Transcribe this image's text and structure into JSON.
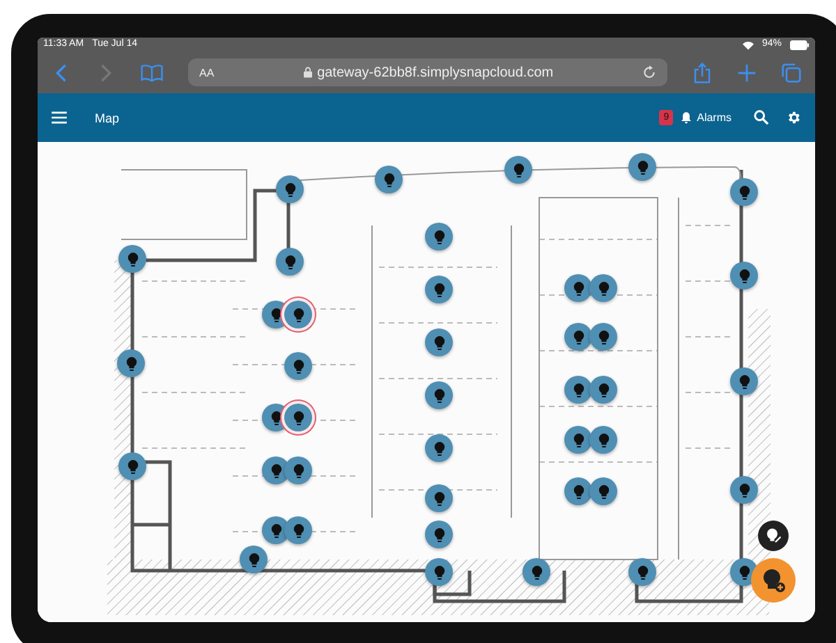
{
  "status_bar": {
    "time": "11:33 AM",
    "date": "Tue Jul 14",
    "battery": "94%"
  },
  "browser": {
    "text_size": "AA",
    "url": "gateway-62bb8f.simplysnapcloud.com"
  },
  "app_bar": {
    "title": "Map",
    "alarm_count": "9",
    "alarms_label": "Alarms"
  },
  "map": {
    "markers": [
      {
        "alarm": false
      },
      {
        "alarm": false
      },
      {
        "alarm": false
      },
      {
        "alarm": false
      },
      {
        "alarm": false
      },
      {
        "alarm": false
      },
      {
        "alarm": false
      },
      {
        "alarm": false
      },
      {
        "alarm": false
      },
      {
        "alarm": false
      },
      {
        "alarm": false
      },
      {
        "alarm": false
      },
      {
        "alarm": true
      },
      {
        "alarm": false
      },
      {
        "alarm": false
      },
      {
        "alarm": false
      },
      {
        "alarm": false
      },
      {
        "alarm": false
      },
      {
        "alarm": false
      },
      {
        "alarm": false
      },
      {
        "alarm": false
      },
      {
        "alarm": false
      },
      {
        "alarm": false
      },
      {
        "alarm": false
      },
      {
        "alarm": true
      },
      {
        "alarm": false
      },
      {
        "alarm": false
      },
      {
        "alarm": false
      },
      {
        "alarm": false
      },
      {
        "alarm": false
      },
      {
        "alarm": false
      },
      {
        "alarm": false
      },
      {
        "alarm": false
      },
      {
        "alarm": false
      },
      {
        "alarm": false
      },
      {
        "alarm": false
      },
      {
        "alarm": false
      },
      {
        "alarm": false
      },
      {
        "alarm": false
      },
      {
        "alarm": false
      },
      {
        "alarm": false
      },
      {
        "alarm": false
      },
      {
        "alarm": false
      }
    ]
  }
}
